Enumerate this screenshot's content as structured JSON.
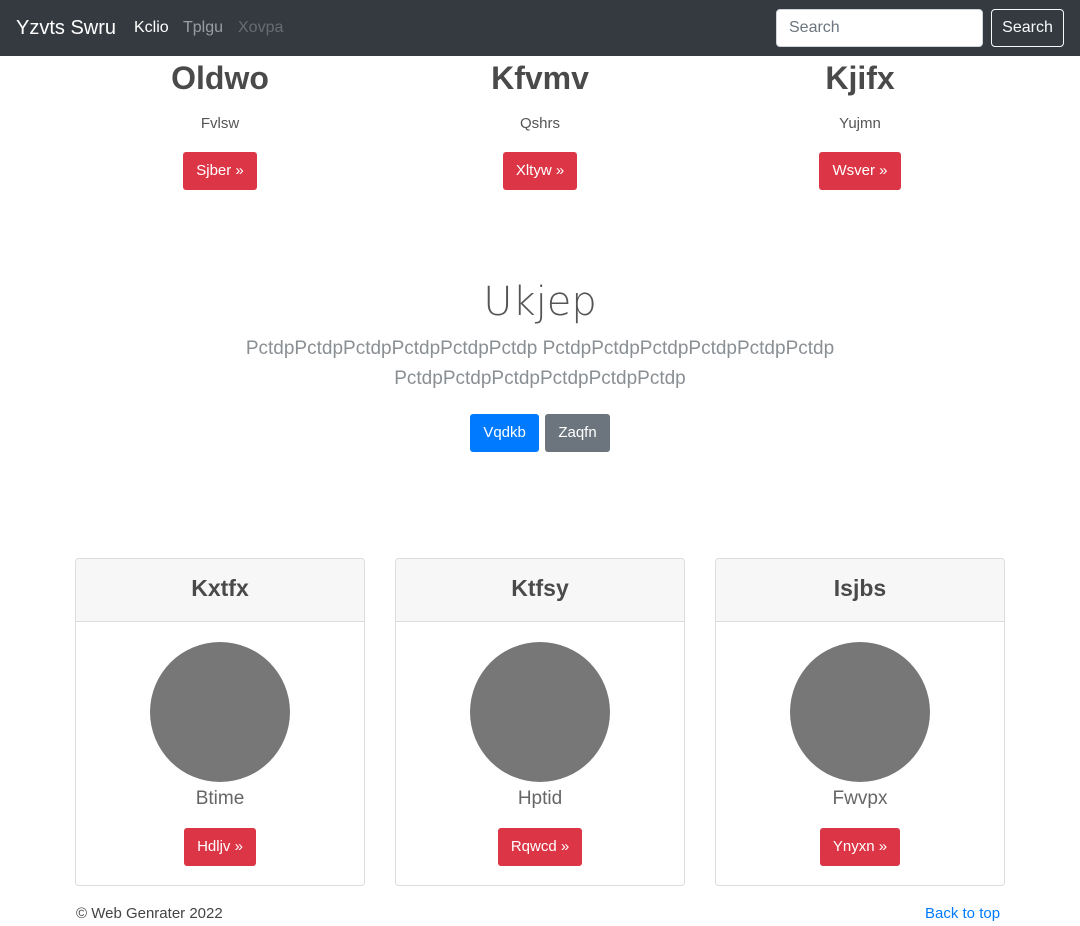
{
  "navbar": {
    "brand": "Yzvts Swru",
    "links": [
      "Kclio",
      "Tplgu",
      "Xovpa"
    ],
    "search_placeholder": "Search",
    "search_button": "Search"
  },
  "features": [
    {
      "title": "Oldwo",
      "text": "Fvlsw",
      "button": "Sjber »"
    },
    {
      "title": "Kfvmv",
      "text": "Qshrs",
      "button": "Xltyw »"
    },
    {
      "title": "Kjifx",
      "text": "Yujmn",
      "button": "Wsver »"
    }
  ],
  "jumbotron": {
    "title": "Ukjep",
    "lead": "PctdpPctdpPctdpPctdpPctdpPctdp PctdpPctdpPctdpPctdpPctdpPctdp PctdpPctdpPctdpPctdpPctdpPctdp",
    "primary_button": "Vqdkb",
    "secondary_button": "Zaqfn"
  },
  "cards": [
    {
      "header": "Kxtfx",
      "name": "Btime",
      "button": "Hdljv »"
    },
    {
      "header": "Ktfsy",
      "name": "Hptid",
      "button": "Rqwcd »"
    },
    {
      "header": "Isjbs",
      "name": "Fwvpx",
      "button": "Ynyxn »"
    }
  ],
  "footer": {
    "copyright": "© Web Genrater 2022",
    "back_to_top": "Back to top"
  },
  "colors": {
    "navbar": "#343a40",
    "danger": "#dc3545",
    "primary": "#007bff",
    "secondary": "#6c757d",
    "avatar": "#777777"
  }
}
